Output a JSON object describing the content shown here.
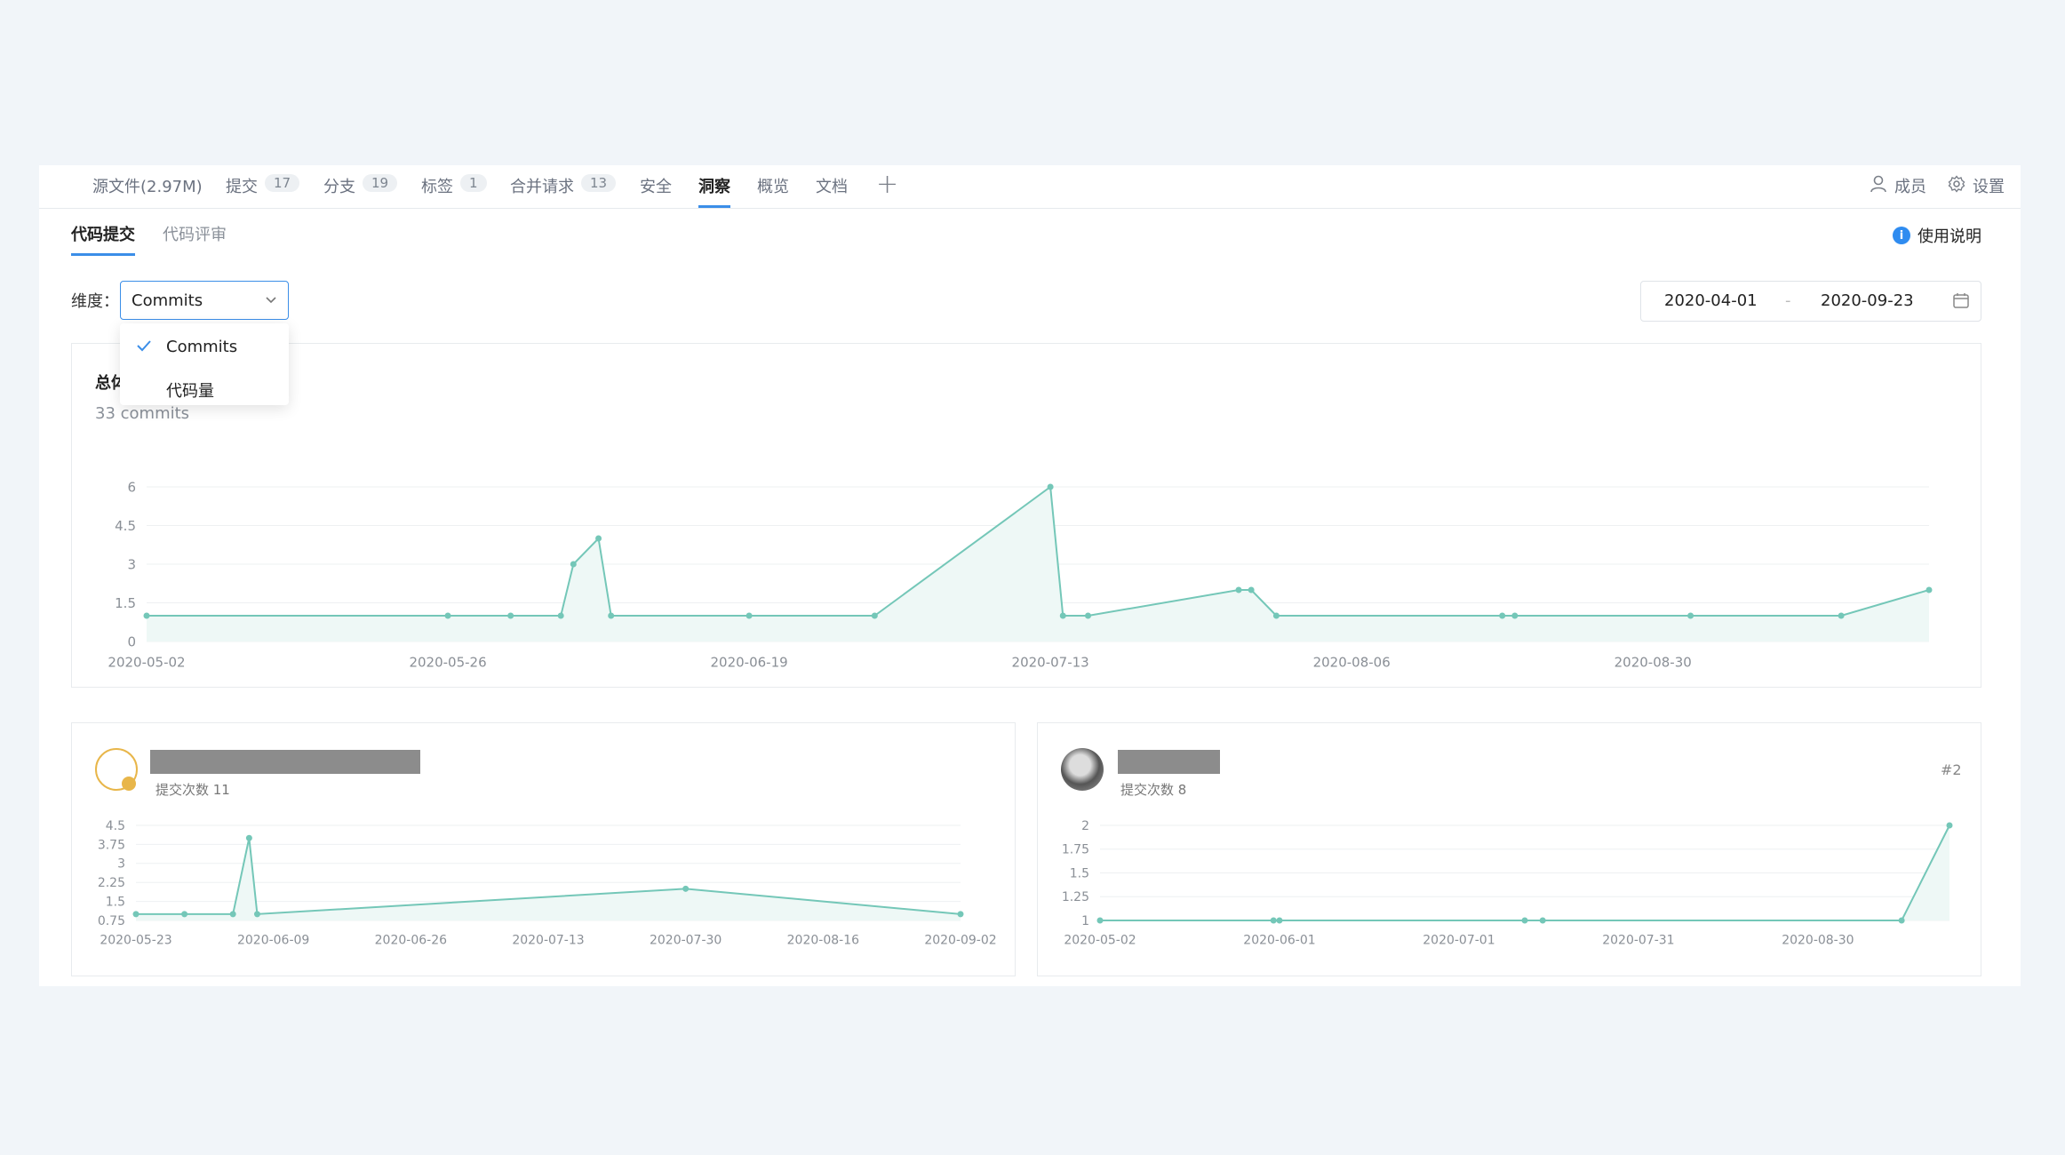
{
  "nav": {
    "tabs": [
      {
        "label": "源文件(2.97M)",
        "badge": ""
      },
      {
        "label": "提交",
        "badge": "17"
      },
      {
        "label": "分支",
        "badge": "19"
      },
      {
        "label": "标签",
        "badge": "1"
      },
      {
        "label": "合并请求",
        "badge": "13"
      },
      {
        "label": "安全",
        "badge": ""
      },
      {
        "label": "洞察",
        "badge": "",
        "active": true
      },
      {
        "label": "概览",
        "badge": ""
      },
      {
        "label": "文档",
        "badge": ""
      }
    ],
    "add": "+",
    "members": "成员",
    "settings": "设置"
  },
  "subtabs": [
    "代码提交",
    "代码评审"
  ],
  "help": {
    "icon": "i",
    "label": "使用说明"
  },
  "dimension": {
    "label": "维度：",
    "selected": "Commits",
    "options": [
      "Commits",
      "代码量"
    ]
  },
  "daterange": {
    "start": "2020-04-01",
    "separator": "-",
    "end": "2020-09-23"
  },
  "overview": {
    "title": "总体",
    "subtitle": "33 commits"
  },
  "contributors": [
    {
      "commits_label": "提交次数 11",
      "rank": ""
    },
    {
      "commits_label": "提交次数 8",
      "rank": "#2"
    }
  ],
  "colors": {
    "accent": "#3b8ee8",
    "line": "#74c7b8",
    "fill": "#eef8f6"
  },
  "chart_data": [
    {
      "type": "area",
      "x": [
        "2020-05-02",
        "2020-05-26",
        "2020-05-31",
        "2020-06-04",
        "2020-06-05",
        "2020-06-07",
        "2020-06-08",
        "2020-06-19",
        "2020-06-29",
        "2020-07-13",
        "2020-07-14",
        "2020-07-16",
        "2020-07-28",
        "2020-07-29",
        "2020-07-31",
        "2020-08-18",
        "2020-08-19",
        "2020-09-02",
        "2020-09-14",
        "2020-09-21"
      ],
      "values": [
        1,
        1,
        1,
        1,
        3,
        4,
        1,
        1,
        1,
        6,
        1,
        1,
        2,
        2,
        1,
        1,
        1,
        1,
        1,
        2
      ],
      "yticks": [
        "0",
        "1.5",
        "3",
        "4.5",
        "6"
      ],
      "xticks": [
        "2020-05-02",
        "2020-05-26",
        "2020-06-19",
        "2020-07-13",
        "2020-08-06",
        "2020-08-30"
      ],
      "ylim": [
        0,
        6
      ]
    },
    {
      "type": "area",
      "x": [
        "2020-05-23",
        "2020-05-29",
        "2020-06-04",
        "2020-06-06",
        "2020-06-07",
        "2020-07-30",
        "2020-09-02"
      ],
      "values": [
        1,
        1,
        1,
        4,
        1,
        2,
        1
      ],
      "yticks": [
        "0.75",
        "1.5",
        "2.25",
        "3",
        "3.75",
        "4.5"
      ],
      "xticks": [
        "2020-05-23",
        "2020-06-09",
        "2020-06-26",
        "2020-07-13",
        "2020-07-30",
        "2020-08-16",
        "2020-09-02"
      ],
      "ylim": [
        0.75,
        4.5
      ]
    },
    {
      "type": "area",
      "x": [
        "2020-05-02",
        "2020-05-31",
        "2020-06-01",
        "2020-07-12",
        "2020-07-15",
        "2020-09-13",
        "2020-09-21"
      ],
      "values": [
        1,
        1,
        1,
        1,
        1,
        1,
        2
      ],
      "yticks": [
        "1",
        "1.25",
        "1.5",
        "1.75",
        "2"
      ],
      "xticks": [
        "2020-05-02",
        "2020-06-01",
        "2020-07-01",
        "2020-07-31",
        "2020-08-30"
      ],
      "ylim": [
        1,
        2
      ]
    }
  ]
}
